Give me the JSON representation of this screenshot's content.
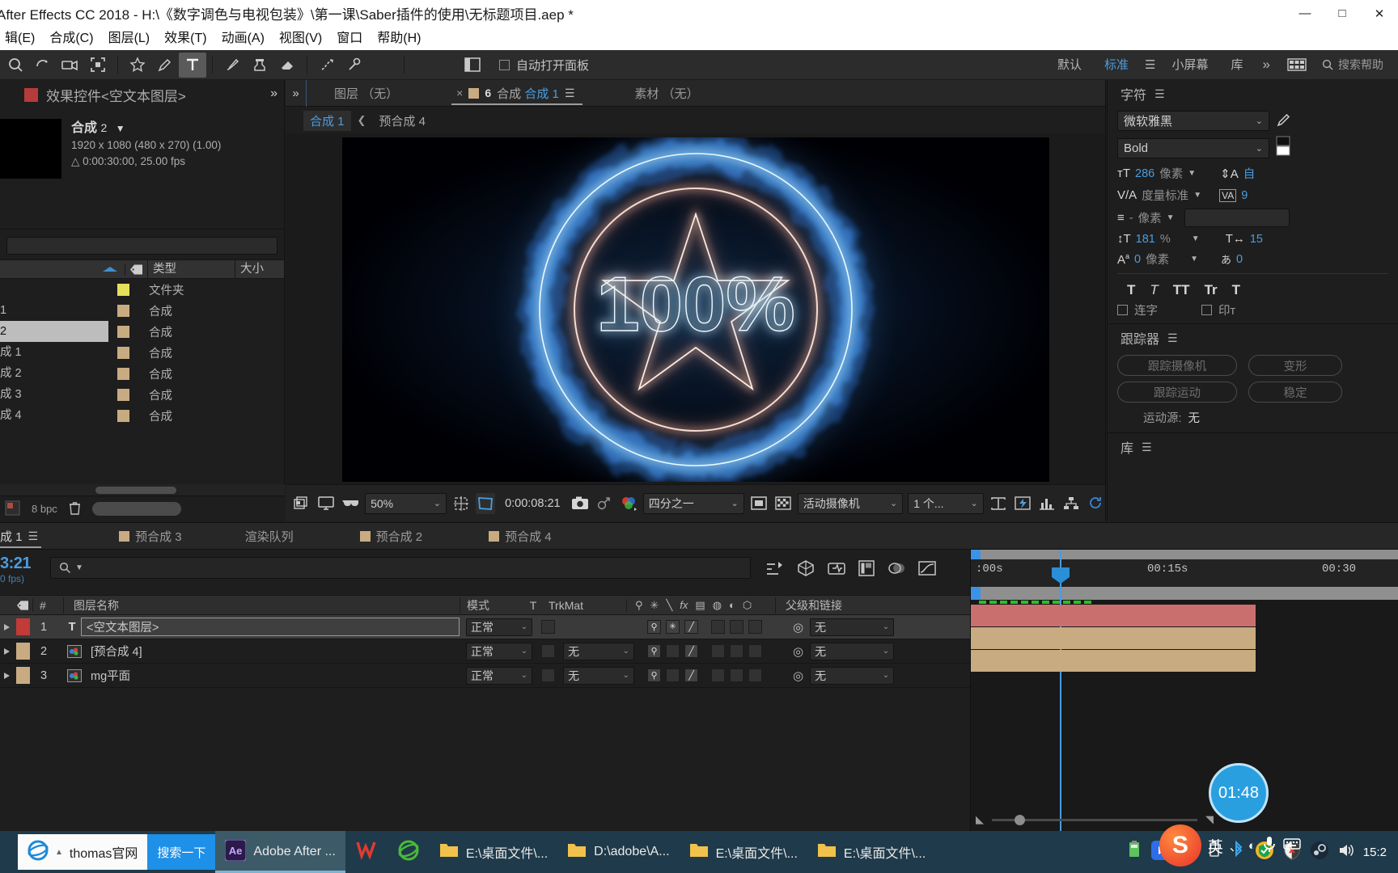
{
  "window": {
    "title": "After Effects CC 2018 - H:\\《数字调色与电视包装》\\第一课\\Saber插件的使用\\无标题项目.aep *",
    "minimize": "—",
    "maximize": "□",
    "close": "✕"
  },
  "menu": {
    "items": [
      "辑(E)",
      "合成(C)",
      "图层(L)",
      "效果(T)",
      "动画(A)",
      "视图(V)",
      "窗口",
      "帮助(H)"
    ]
  },
  "toolbar": {
    "auto_open_panel_label": "自动打开面板",
    "workspaces": [
      "默认",
      "标准",
      "小屏幕",
      "库"
    ],
    "selected_workspace": "标准",
    "more_label": "»",
    "search_placeholder": "搜索帮助"
  },
  "effect_controls": {
    "tab_label": "效果控件<空文本图层>",
    "comp_name": "合成",
    "comp_number": "2",
    "resolution": "1920 x 1080  (480 x 270) (1.00)",
    "duration": "△ 0:00:30:00, 25.00 fps",
    "expand_label": "»"
  },
  "project": {
    "columns": [
      "",
      "",
      "类型",
      "大小"
    ],
    "rows": [
      {
        "name": "",
        "type": "文件夹",
        "color": "#e6e05a",
        "selected": false
      },
      {
        "name": "1",
        "type": "合成",
        "color": "#c9ab82",
        "selected": false
      },
      {
        "name": "2",
        "type": "合成",
        "color": "#c9ab82",
        "selected": true
      },
      {
        "name": "成 1",
        "type": "合成",
        "color": "#c9ab82",
        "selected": false
      },
      {
        "name": "成 2",
        "type": "合成",
        "color": "#c9ab82",
        "selected": false
      },
      {
        "name": "成 3",
        "type": "合成",
        "color": "#c9ab82",
        "selected": false
      },
      {
        "name": "成 4",
        "type": "合成",
        "color": "#c9ab82",
        "selected": false
      }
    ],
    "bit_depth": "8 bpc"
  },
  "composition": {
    "tabs": [
      {
        "label": "图层 （无）",
        "selected": false,
        "has_close": false
      },
      {
        "label": "合成 合成 1",
        "selected": true,
        "has_close": true
      },
      {
        "label": "素材 （无）",
        "selected": false,
        "has_close": false
      }
    ],
    "subtabs": [
      {
        "label": "合成 1",
        "selected": true
      },
      {
        "label": "预合成 4",
        "selected": false
      }
    ],
    "viewer": {
      "zoom": "50%",
      "timecode": "0:00:08:21",
      "resolution": "四分之一",
      "camera": "活动摄像机",
      "views": "1 个..."
    },
    "preview_text": "100%"
  },
  "character_panel": {
    "title": "字符",
    "font_family": "微软雅黑",
    "font_style": "Bold",
    "font_size": "286",
    "font_size_unit": "像素",
    "leading": "自",
    "kerning": "度量标准",
    "tracking": "9",
    "stroke_width": "-",
    "stroke_unit": "像素",
    "vertical_scale": "181",
    "vertical_scale_unit": "%",
    "horizontal_scale": "15",
    "baseline_shift": "0",
    "baseline_unit": "像素",
    "tsume": "0",
    "styles": [
      "T",
      "T",
      "TT",
      "Tr",
      "T"
    ],
    "ligature_label": "连字",
    "print_label": "印т"
  },
  "tracker_panel": {
    "title": "跟踪器",
    "buttons": [
      "跟踪摄像机",
      "变形",
      "跟踪运动",
      "稳定"
    ],
    "motion_source_label": "运动源:",
    "motion_source_value": "无"
  },
  "library_panel": {
    "title": "库"
  },
  "timeline": {
    "tabs": [
      {
        "label": "成 1",
        "selected": true,
        "has_sq": false
      },
      {
        "label": "预合成 3",
        "selected": false,
        "has_sq": true
      },
      {
        "label": "渲染队列",
        "selected": false,
        "has_sq": false
      },
      {
        "label": "预合成 2",
        "selected": false,
        "has_sq": true
      },
      {
        "label": "预合成 4",
        "selected": false,
        "has_sq": true
      }
    ],
    "current_time": "3:21",
    "current_fps": "0 fps)",
    "columns": [
      "#",
      "图层名称",
      "模式",
      "T",
      "TrkMat",
      "父级和链接"
    ],
    "layers": [
      {
        "index": "1",
        "name": "<空文本图层>",
        "label_color": "#c23b36",
        "type_icon": "T",
        "mode": "正常",
        "trkmat": "",
        "parent": "无",
        "selected": true,
        "bar_color": "#c9706e",
        "has_trkmat": false
      },
      {
        "index": "2",
        "name": "[预合成 4]",
        "label_color": "#c9ab82",
        "type_icon": "comp",
        "mode": "正常",
        "trkmat": "无",
        "parent": "无",
        "selected": false,
        "bar_color": "#c9ab82",
        "has_trkmat": true
      },
      {
        "index": "3",
        "name": "mg平面",
        "label_color": "#c9ab82",
        "type_icon": "comp",
        "mode": "正常",
        "trkmat": "无",
        "parent": "无",
        "selected": false,
        "bar_color": "#c9ab82",
        "has_trkmat": true
      }
    ],
    "ruler_labels": [
      ":00s",
      "00:15s",
      "00:30"
    ]
  },
  "taskbar": {
    "browser_label": "thomas官网",
    "search_button": "搜索一下",
    "items": [
      {
        "label": "Adobe After ...",
        "icon": "ae-icon",
        "active": true
      },
      {
        "label": "",
        "icon": "wps-icon",
        "active": false
      },
      {
        "label": "",
        "icon": "browser-icon",
        "active": false
      },
      {
        "label": "E:\\桌面文件\\...",
        "icon": "folder-icon",
        "active": false
      },
      {
        "label": "D:\\adobe\\A...",
        "icon": "folder-icon",
        "active": false
      },
      {
        "label": "E:\\桌面文件\\...",
        "icon": "folder-icon",
        "active": false
      },
      {
        "label": "E:\\桌面文件\\...",
        "icon": "folder-icon",
        "active": false
      }
    ],
    "clock": "15:2",
    "ime_label": "英",
    "bubble_time": "01:48"
  }
}
